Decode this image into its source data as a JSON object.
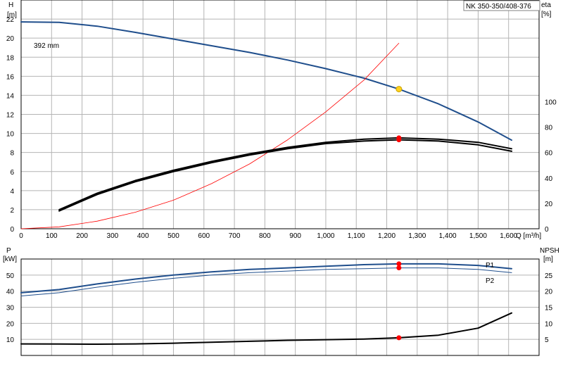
{
  "chart_data": [
    {
      "type": "line",
      "title": "NK 350-350/408-376",
      "xlabel": "Q [m³/h]",
      "ylabel_left": [
        "H",
        "[m]"
      ],
      "ylabel_right": [
        "eta",
        "[%]"
      ],
      "xlim": [
        0,
        1700
      ],
      "ylim_left": [
        0,
        24
      ],
      "ylim_right": [
        0,
        180
      ],
      "x_ticks": [
        0,
        100,
        200,
        300,
        400,
        500,
        600,
        700,
        800,
        900,
        1000,
        1100,
        1200,
        1300,
        1400,
        1500,
        1600
      ],
      "x_tick_labels": [
        "0",
        "100",
        "200",
        "300",
        "400",
        "500",
        "600",
        "700",
        "800",
        "900",
        "1,000",
        "1,100",
        "1,200",
        "1,300",
        "1,400",
        "1,500",
        "1,600",
        "Q [m³/h]"
      ],
      "y_ticks_left": [
        0,
        2,
        4,
        6,
        8,
        10,
        12,
        14,
        16,
        18,
        20,
        22
      ],
      "y_tick_labels_left": [
        "0",
        "2",
        "4",
        "6",
        "8",
        "10",
        "12",
        "14",
        "16",
        "18",
        "20",
        "22"
      ],
      "y_ticks_right": [
        0,
        20,
        40,
        60,
        80,
        100
      ],
      "y_tick_labels_right": [
        "0",
        "20",
        "40",
        "60",
        "80",
        "100"
      ],
      "grid": true,
      "annotations": [
        {
          "text": "392 mm",
          "x": 80,
          "y": 22.2
        }
      ],
      "series": [
        {
          "axis": "left",
          "color": "#1f4e8c",
          "width": 2,
          "x": [
            0,
            125,
            250,
            375,
            500,
            625,
            750,
            875,
            1000,
            1125,
            1240,
            1370,
            1500,
            1610
          ],
          "y": [
            21.7,
            21.65,
            21.25,
            20.6,
            19.9,
            19.2,
            18.5,
            17.7,
            16.8,
            15.8,
            14.65,
            13.1,
            11.2,
            9.3
          ]
        },
        {
          "axis": "right",
          "color": "#ff0000",
          "width": 0.8,
          "x": [
            0,
            125,
            250,
            375,
            500,
            625,
            750,
            875,
            1000,
            1125,
            1240
          ],
          "y": [
            0,
            1.5,
            6,
            13,
            22.5,
            35.5,
            51,
            70,
            92,
            117,
            146
          ]
        },
        {
          "axis": "right",
          "color": "#000000",
          "width": 2,
          "x": [
            125,
            250,
            375,
            500,
            625,
            750,
            875,
            1000,
            1125,
            1240,
            1370,
            1500,
            1610
          ],
          "y": [
            14,
            27,
            37,
            45,
            52,
            58,
            63,
            67,
            69,
            70,
            69,
            66,
            61
          ]
        },
        {
          "axis": "right",
          "color": "#000000",
          "width": 2,
          "x": [
            125,
            250,
            375,
            500,
            625,
            750,
            875,
            1000,
            1125,
            1240,
            1370,
            1500,
            1610
          ],
          "y": [
            15,
            28,
            38,
            46,
            53,
            59,
            64,
            68,
            70.5,
            71.5,
            70.5,
            68,
            63
          ]
        }
      ],
      "markers": [
        {
          "x": 1240,
          "y": 14.65,
          "axis": "left",
          "color": "#ffd21e"
        },
        {
          "x": 1240,
          "y": 71.5,
          "axis": "right",
          "color": "#ff0000"
        },
        {
          "x": 1240,
          "y": 70,
          "axis": "right",
          "color": "#ff0000"
        }
      ]
    },
    {
      "type": "line",
      "ylabel_left": [
        "P",
        "[kW]"
      ],
      "ylabel_right": [
        "NPSH",
        "[m]"
      ],
      "xlim": [
        0,
        1700
      ],
      "ylim_left": [
        0,
        60
      ],
      "ylim_right": [
        0,
        30
      ],
      "y_ticks_left": [
        10,
        20,
        30,
        40,
        50
      ],
      "y_tick_labels_left": [
        "10",
        "20",
        "30",
        "40",
        "50"
      ],
      "y_ticks_right": [
        5,
        10,
        15,
        20,
        25
      ],
      "y_tick_labels_right": [
        "5",
        "10",
        "15",
        "20",
        "25"
      ],
      "grid": true,
      "series": [
        {
          "name": "P1",
          "axis": "left",
          "color": "#1f4e8c",
          "width": 2,
          "x": [
            0,
            125,
            250,
            375,
            500,
            625,
            750,
            875,
            1000,
            1125,
            1240,
            1370,
            1500,
            1610
          ],
          "y": [
            39,
            41,
            44.5,
            47.5,
            50,
            52,
            53.5,
            54.5,
            55.5,
            56.5,
            57,
            57,
            56,
            54
          ]
        },
        {
          "name": "P2",
          "axis": "left",
          "color": "#1f4e8c",
          "width": 1,
          "x": [
            0,
            125,
            250,
            375,
            500,
            625,
            750,
            875,
            1000,
            1125,
            1240,
            1370,
            1500,
            1610
          ],
          "y": [
            37,
            39,
            42.5,
            45.5,
            48,
            50,
            51.5,
            52.5,
            53.5,
            54,
            54.5,
            54.5,
            53.5,
            51.5
          ]
        },
        {
          "axis": "right",
          "color": "#000000",
          "width": 2,
          "x": [
            0,
            125,
            250,
            375,
            500,
            625,
            750,
            875,
            1000,
            1125,
            1240,
            1370,
            1500,
            1610
          ],
          "y": [
            3.6,
            3.55,
            3.5,
            3.6,
            3.8,
            4.1,
            4.4,
            4.7,
            4.9,
            5.1,
            5.5,
            6.3,
            8.5,
            13.2
          ]
        }
      ],
      "markers": [
        {
          "x": 1240,
          "y": 57,
          "axis": "left",
          "color": "#ff0000"
        },
        {
          "x": 1240,
          "y": 54.5,
          "axis": "left",
          "color": "#ff0000"
        },
        {
          "x": 1240,
          "y": 5.5,
          "axis": "right",
          "color": "#ff0000"
        }
      ]
    }
  ]
}
